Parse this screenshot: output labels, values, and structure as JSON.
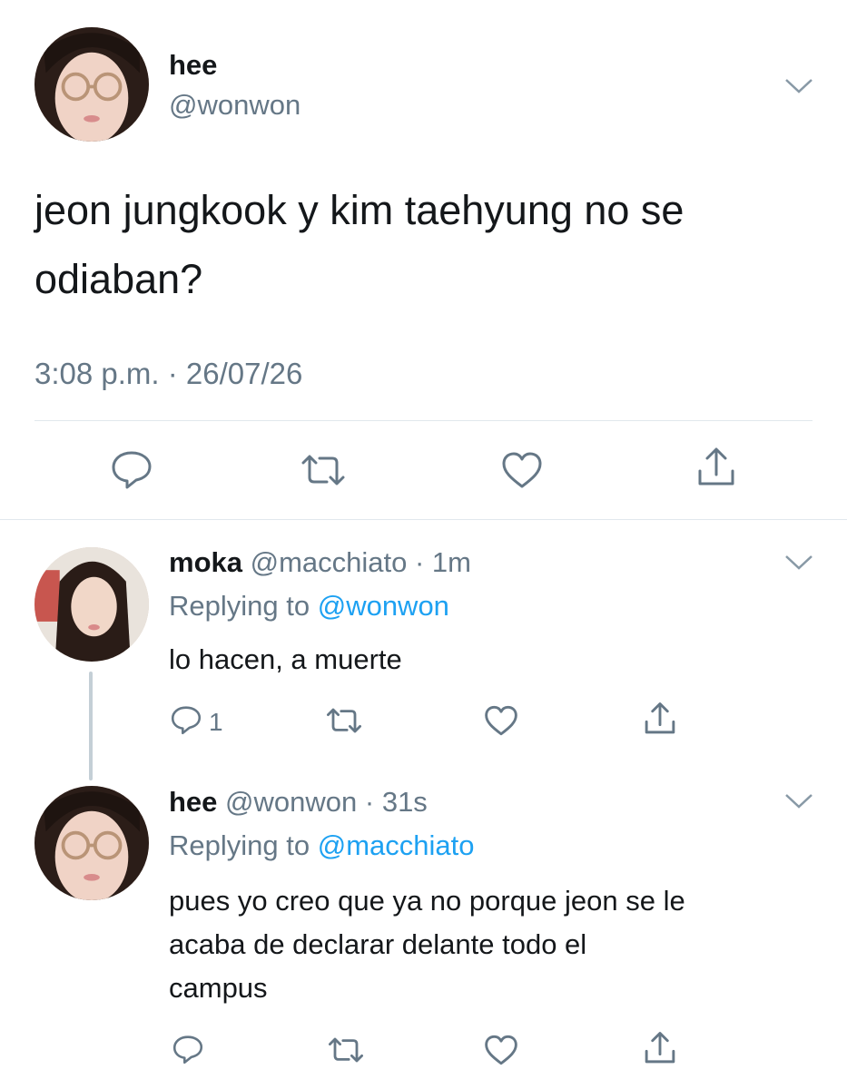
{
  "main_tweet": {
    "display_name": "hee",
    "handle": "@wonwon",
    "text_line1": "jeon jungkook y kim taehyung no se",
    "text_line2": "odiaban?",
    "timestamp": "3:08 p.m. · 26/07/26",
    "actions": [
      "reply-icon",
      "retweet-icon",
      "like-icon",
      "share-icon"
    ]
  },
  "replies": [
    {
      "display_name": "moka",
      "handle": "@macchiato",
      "time": "· 1m",
      "replying_prefix": "Replying to",
      "replying_to": "@wonwon",
      "text_lines": [
        "lo hacen, a muerte"
      ],
      "reply_count": "1"
    },
    {
      "display_name": "hee",
      "handle": "@wonwon",
      "time": "· 31s",
      "replying_prefix": "Replying to",
      "replying_to": "@macchiato",
      "text_lines": [
        "pues yo creo que ya no porque jeon se le",
        "acaba de declarar delante todo el",
        "campus"
      ],
      "reply_count": ""
    }
  ],
  "colors": {
    "text": "#14171a",
    "muted": "#657786",
    "link": "#1da1f2",
    "divider": "#e1e8ed",
    "thread_line": "#c4cfd6"
  }
}
